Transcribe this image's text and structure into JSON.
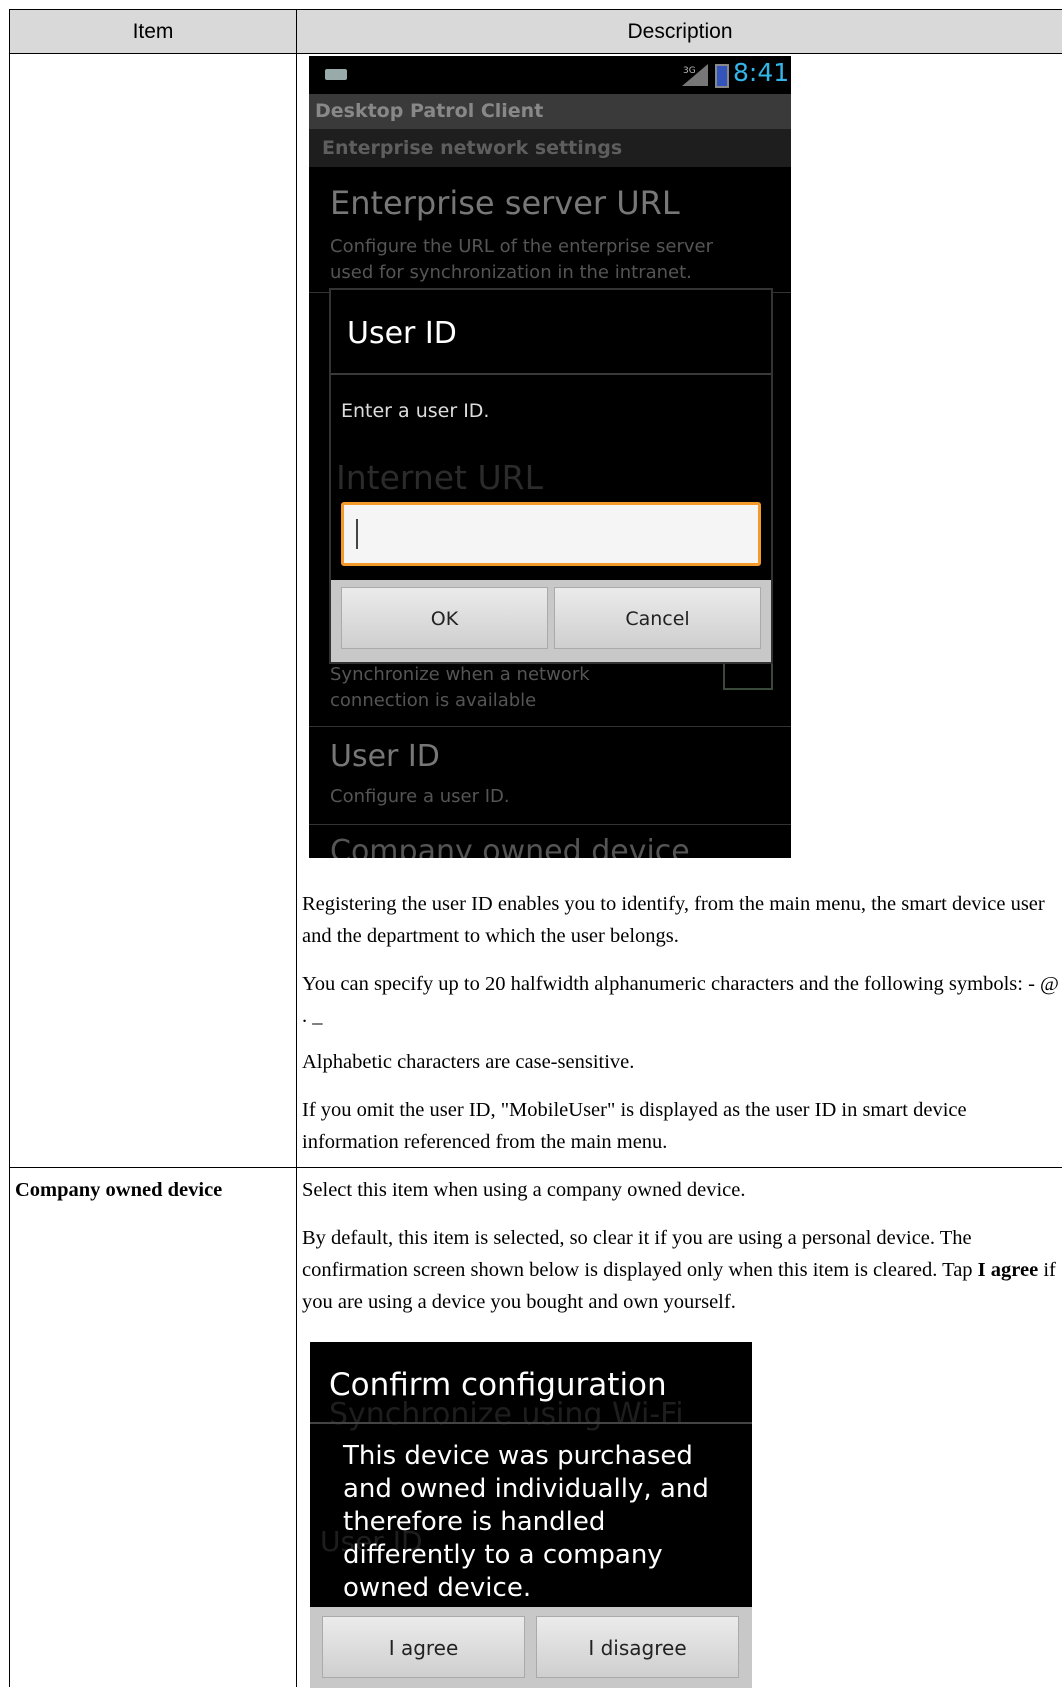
{
  "table": {
    "header": {
      "item": "Item",
      "description": "Description"
    }
  },
  "row1": {
    "screenshot": {
      "time": "8:41",
      "signal": "3G",
      "app_title": "Desktop Patrol Client",
      "section": "Enterprise network settings",
      "bg_setting_title": "Enterprise server URL",
      "bg_setting_desc1": "Configure the URL of the enterprise server",
      "bg_setting_desc2": "used for synchronization in the intranet.",
      "bg_sync1": "Synchronize when a network",
      "bg_sync2": "connection is available",
      "bg_userid_title": "User ID",
      "bg_userid_desc": "Configure a user ID.",
      "bg_company": "Company owned device",
      "dialog": {
        "title": "User ID",
        "message": "Enter a user ID.",
        "ghost": "Internet URL",
        "input_value": "",
        "ok": "OK",
        "cancel": "Cancel"
      }
    },
    "p1": "Registering the user ID enables you to identify, from the main menu, the smart device user and the department to which the user belongs.",
    "p2": "You can specify up to 20 halfwidth alphanumeric characters and the following symbols: - @ . _",
    "p3": "Alphabetic characters are case-sensitive.",
    "p4": "If you omit the user ID, \"MobileUser\" is displayed as the user ID in smart device information referenced from the main menu."
  },
  "row2": {
    "item": "Company owned device",
    "p1": "Select this item when using a company owned device.",
    "p2_part1": "By default, this item is selected, so clear it if you are using a personal device. The confirmation screen shown below is displayed only when this item is cleared. Tap ",
    "p2_bold": "I agree",
    "p2_part2": " if you are using a device you bought and own yourself.",
    "screenshot": {
      "title": "Confirm configuration",
      "ghost1": "Synchronize using Wi-Fi",
      "ghost2": "User ID",
      "body": "This device was purchased and owned individually, and therefore is handled differently to a company owned device.",
      "agree": "I agree",
      "disagree": "I disagree"
    }
  }
}
